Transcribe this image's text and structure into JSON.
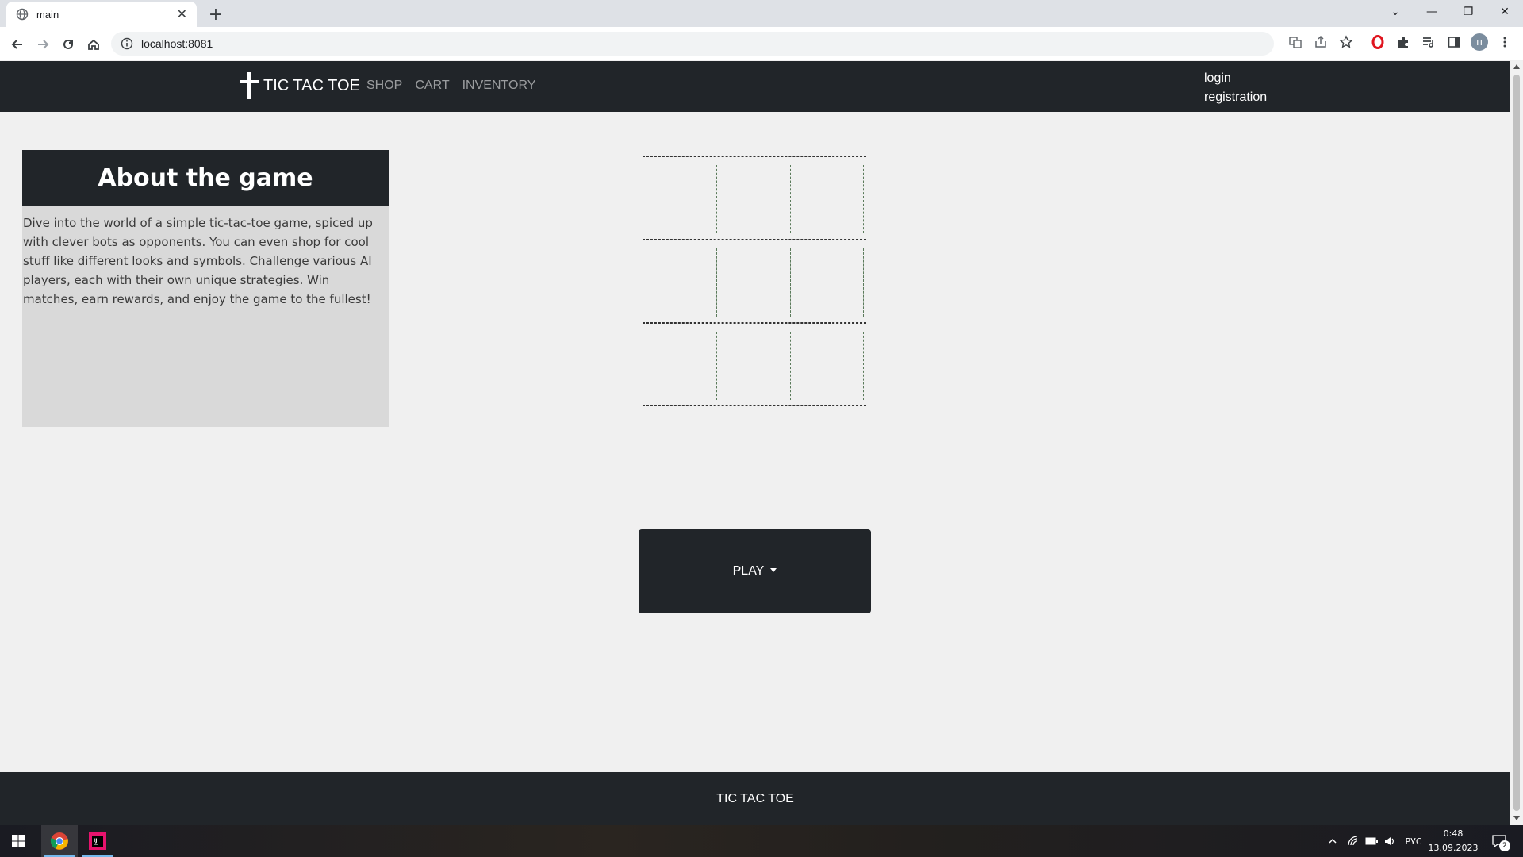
{
  "browser": {
    "tab_title": "main",
    "new_tab_symbol": "+",
    "url": "localhost:8081",
    "icons": [
      "globe-icon",
      "close-icon",
      "back-icon",
      "forward-icon",
      "reload-icon",
      "home-icon",
      "info-icon",
      "translate-icon",
      "share-icon",
      "star-icon",
      "opera-icon",
      "extensions-icon",
      "reading-list-icon",
      "side-panel-icon",
      "profile-avatar",
      "menu-icon"
    ],
    "profile_initial": "п"
  },
  "site": {
    "brand": "TIC TAC TOE",
    "nav": [
      "SHOP",
      "CART",
      "INVENTORY"
    ],
    "auth": {
      "login": "login",
      "registration": "registration"
    },
    "about": {
      "title": "About the game",
      "text": "Dive into the world of a simple tic-tac-toe game, spiced up with clever bots as opponents. You can even shop for cool stuff like different looks and symbols. Challenge various AI players, each with their own unique strategies. Win matches, earn rewards, and enjoy the game to the fullest!"
    },
    "board": {
      "rows": 3,
      "cols": 3,
      "cells": [
        "",
        "",
        "",
        "",
        "",
        "",
        "",
        "",
        ""
      ]
    },
    "play_button": "PLAY",
    "footer": "TIC TAC TOE"
  },
  "taskbar": {
    "language": "РУС",
    "time": "0:48",
    "date": "13.09.2023",
    "notifications": "2",
    "accent": "#76b9ed"
  }
}
